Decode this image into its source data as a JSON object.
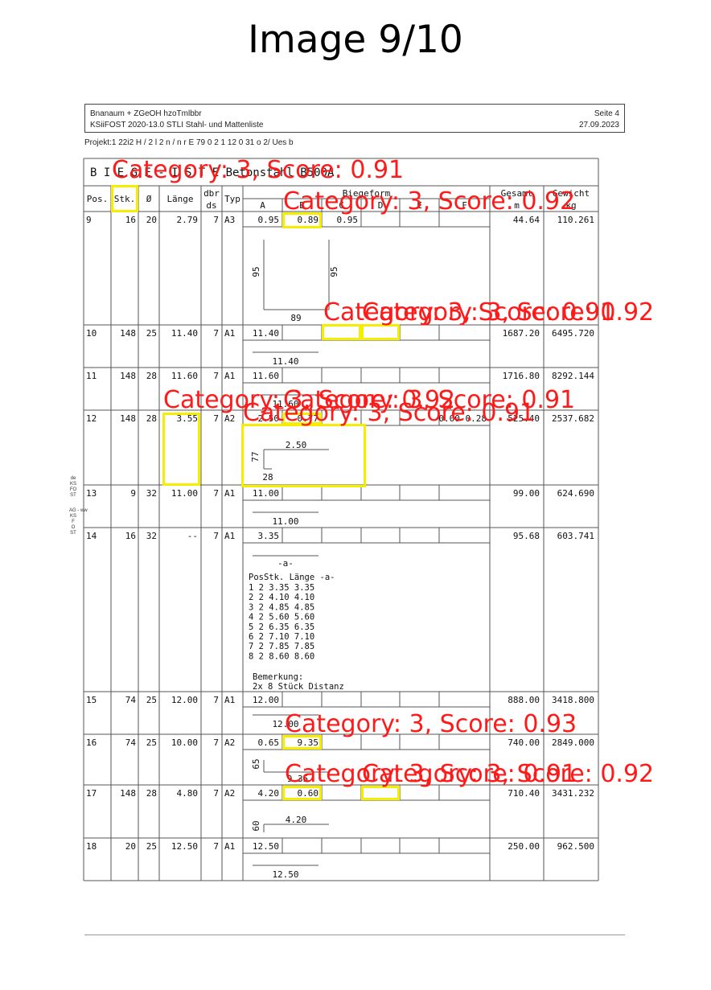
{
  "image_title": "Image 9/10",
  "header": {
    "line1": "Bnanaum  + ZGeOH hzoTmlbbr",
    "line2": "KSiiFOST  2020-13.0  STLI Stahl- und Mattenliste",
    "page": "Seite 4",
    "date": "27.09.2023"
  },
  "projekt": "Projekt:1 22i2 H  / 2 l 2  n    / n  r  E 79  0 2 1 12    0      31 o  2/   Ues    b",
  "side_marks": {
    "top": "de\nKS\nFO\nST",
    "bottom": "AG - ww\nKS\nF\nO\nST"
  },
  "table": {
    "section_title": "B I E G E - I S T E  Betonstahl  B500A",
    "headers": {
      "pos": "Pos.",
      "stk": "Stk.",
      "dia": "Ø",
      "laenge": "Länge",
      "dbr": "dbr ds",
      "typ": "Typ",
      "biegeform": "Biegeform",
      "cols": [
        "A",
        "B",
        "C",
        "D",
        "E",
        "F"
      ],
      "gesamt": "Gesamt m",
      "gewicht": "Gewicht kg"
    },
    "rows": [
      {
        "pos": "9",
        "stk": "16",
        "dia": "20",
        "laenge": "2.79",
        "dbr": "7",
        "typ": "A3",
        "A": "0.95",
        "B": "0.89",
        "C": "0.95",
        "D": "",
        "E": "",
        "F": "",
        "gesamt": "44.64",
        "gewicht": "110.261"
      },
      {
        "pos": "10",
        "stk": "148",
        "dia": "25",
        "laenge": "11.40",
        "dbr": "7",
        "typ": "A1",
        "A": "11.40",
        "B": "",
        "C": "",
        "D": "",
        "E": "",
        "F": "",
        "gesamt": "1687.20",
        "gewicht": "6495.720"
      },
      {
        "pos": "11",
        "stk": "148",
        "dia": "28",
        "laenge": "11.60",
        "dbr": "7",
        "typ": "A1",
        "A": "11.60",
        "B": "",
        "C": "",
        "D": "",
        "E": "",
        "F": "",
        "gesamt": "1716.80",
        "gewicht": "8292.144"
      },
      {
        "pos": "12",
        "stk": "148",
        "dia": "28",
        "laenge": "3.55",
        "dbr": "7",
        "typ": "A2",
        "A": "2.50",
        "B": "0.77",
        "C": "",
        "D": "",
        "E": "",
        "F": "0.00 0.28",
        "gesamt": "525.40",
        "gewicht": "2537.682"
      },
      {
        "pos": "13",
        "stk": "9",
        "dia": "32",
        "laenge": "11.00",
        "dbr": "7",
        "typ": "A1",
        "A": "11.00",
        "B": "",
        "C": "",
        "D": "",
        "E": "",
        "F": "",
        "gesamt": "99.00",
        "gewicht": "624.690"
      },
      {
        "pos": "14",
        "stk": "16",
        "dia": "32",
        "laenge": "--",
        "dbr": "7",
        "typ": "A1",
        "A": "3.35",
        "B": "",
        "C": "",
        "D": "",
        "E": "",
        "F": "",
        "gesamt": "95.68",
        "gewicht": "603.741"
      },
      {
        "pos": "15",
        "stk": "74",
        "dia": "25",
        "laenge": "12.00",
        "dbr": "7",
        "typ": "A1",
        "A": "12.00",
        "B": "",
        "C": "",
        "D": "",
        "E": "",
        "F": "",
        "gesamt": "888.00",
        "gewicht": "3418.800"
      },
      {
        "pos": "16",
        "stk": "74",
        "dia": "25",
        "laenge": "10.00",
        "dbr": "7",
        "typ": "A2",
        "A": "0.65",
        "B": "9.35",
        "C": "",
        "D": "",
        "E": "",
        "F": "",
        "gesamt": "740.00",
        "gewicht": "2849.000"
      },
      {
        "pos": "17",
        "stk": "148",
        "dia": "28",
        "laenge": "4.80",
        "dbr": "7",
        "typ": "A2",
        "A": "4.20",
        "B": "0.60",
        "C": "",
        "D": "",
        "E": "",
        "F": "",
        "gesamt": "710.40",
        "gewicht": "3431.232"
      },
      {
        "pos": "18",
        "stk": "20",
        "dia": "25",
        "laenge": "12.50",
        "dbr": "7",
        "typ": "A1",
        "A": "12.50",
        "B": "",
        "C": "",
        "D": "",
        "E": "",
        "F": "",
        "gesamt": "250.00",
        "gewicht": "962.500"
      }
    ],
    "sketch_labels": {
      "r9": {
        "left": "95",
        "bottom": "89",
        "right": "95"
      },
      "r10": "11.40",
      "r11": "11.60",
      "r12": {
        "top": "2.50",
        "left": "77",
        "bottom": "28"
      },
      "r13": "11.00",
      "r14": {
        "dash_label": "-a-",
        "list_header": "PosStk. Länge   -a-",
        "list": [
          "1      2  3.35  3.35",
          "2      2  4.10  4.10",
          "3      2  4.85  4.85",
          "4      2  5.60  5.60",
          "5      2  6.35  6.35",
          "6      2  7.10  7.10",
          "7      2  7.85  7.85",
          "8      2  8.60  8.60"
        ],
        "bemerkung": "Bemerkung:",
        "note": "2x 8 Stück Distanz"
      },
      "r15": "12.00",
      "r16": {
        "left": "65",
        "bottom": "9.35"
      },
      "r17": {
        "top": "4.20",
        "left": "60"
      },
      "r18": "12.50"
    }
  },
  "detections": [
    "Category: 3, Score: 0.91",
    "Category: 3, Score: 0.92",
    "Category: 3, Score: 0.91",
    "Category: 3, Score: 0.92",
    "Category: 3, Score: 0.92",
    "Category: 3, Score: 0.91",
    "Category: 3, Score: 0.91",
    "Category: 3, Score: 0.93",
    "Category: 3, Score: 0.91",
    "Category: 3, Score: 0.92"
  ],
  "colors": {
    "box": "#f5ee00",
    "label": "#ff1a1a"
  }
}
